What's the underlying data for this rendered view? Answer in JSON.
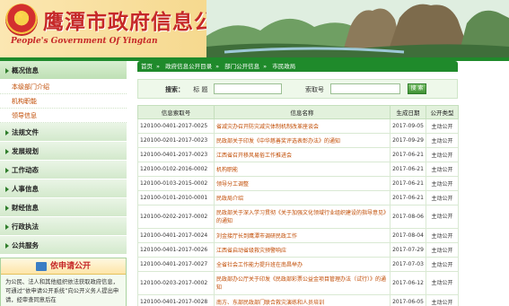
{
  "banner": {
    "title_cn": "鹰潭市政府信息公开",
    "title_en": "People's Government Of Yingtan"
  },
  "sidebar": {
    "menu": [
      {
        "label": "概况信息",
        "open": true,
        "sub": [
          "本级部门介绍",
          "机构职能",
          "领导信息"
        ]
      },
      {
        "label": "法规文件"
      },
      {
        "label": "发展规划"
      },
      {
        "label": "工作动态"
      },
      {
        "label": "人事信息"
      },
      {
        "label": "财经信息"
      },
      {
        "label": "行政执法"
      },
      {
        "label": "公共服务"
      }
    ],
    "apply": {
      "heading": "依申请公开",
      "text": "为公民、法人和其他组织依法获取政府信息，可通过“依申请公开系统”向公开义务人提出申请，经审查同意后在"
    }
  },
  "breadcrumb": [
    "首页",
    "政府信息公开目录",
    "部门公开信息",
    "市民政局"
  ],
  "search": {
    "label": "搜索：",
    "title_label": "标 题",
    "doc_label": "索取号",
    "button": "搜 索",
    "title_value": "",
    "doc_value": ""
  },
  "table": {
    "headers": [
      "信息索取号",
      "信息名称",
      "生成日期",
      "公开类型"
    ],
    "rows": [
      {
        "id": "120100-0401-2017-0025",
        "name": "省减灾办召开防灾减灾体制机制改革座谈会",
        "date": "2017-09-05",
        "type": "主动公开"
      },
      {
        "id": "120100-0201-2017-0023",
        "name": "民政部关于印发《中华慈善奖评选表彰办法》的通知",
        "date": "2017-09-29",
        "type": "主动公开"
      },
      {
        "id": "120100-0401-2017-0023",
        "name": "江西省召开移风易俗工作推进会",
        "date": "2017-06-21",
        "type": "主动公开"
      },
      {
        "id": "120100-0102-2016-0002",
        "name": "机构职能",
        "date": "2017-06-21",
        "type": "主动公开"
      },
      {
        "id": "120100-0103-2015-0002",
        "name": "领导分工调整",
        "date": "2017-06-21",
        "type": "主动公开"
      },
      {
        "id": "120100-0101-2010-0001",
        "name": "民政局介绍",
        "date": "2017-06-21",
        "type": "主动公开"
      },
      {
        "id": "120100-0202-2017-0002",
        "name": "民政部关于深入学习贯彻《关于加强文化领域行业组织建设的指导意见》的通知",
        "date": "2017-08-06",
        "type": "主动公开",
        "tall": true
      },
      {
        "id": "120100-0401-2017-0024",
        "name": "刘金接厅长到鹰潭市调研民政工作",
        "date": "2017-08-04",
        "type": "主动公开"
      },
      {
        "id": "120100-0401-2017-0026",
        "name": "江西省启动省级救灾预警响应",
        "date": "2017-07-29",
        "type": "主动公开"
      },
      {
        "id": "120100-0401-2017-0027",
        "name": "全省社会工作能力提升班在南昌举办",
        "date": "2017-07-03",
        "type": "主动公开"
      },
      {
        "id": "120100-0203-2017-0002",
        "name": "民政部办公厅关于印发《民政部彩票公益金项目管理办法（试行）》的通知",
        "date": "2017-06-12",
        "type": "主动公开",
        "tall": true
      },
      {
        "id": "120100-0401-2017-0028",
        "name": "南方、东部民政部门联合救灾演练和人员培训",
        "date": "2017-06-05",
        "type": "主动公开"
      }
    ]
  }
}
